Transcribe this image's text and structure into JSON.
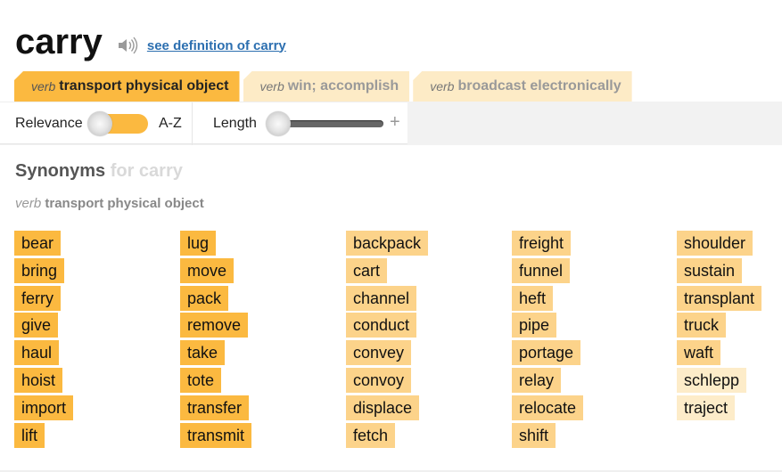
{
  "header": {
    "headword": "carry",
    "speaker_icon": "speaker-icon",
    "definition_link": "see definition of carry"
  },
  "tabs": [
    {
      "pos": "verb",
      "sense": "transport physical object",
      "active": true
    },
    {
      "pos": "verb",
      "sense": "win; accomplish",
      "active": false
    },
    {
      "pos": "verb",
      "sense": "broadcast electronically",
      "active": false
    }
  ],
  "controls": {
    "sort_left_label": "Relevance",
    "sort_right_label": "A-Z",
    "sort_value": "Relevance",
    "length_label": "Length",
    "length_value": 0,
    "plus_label": "+"
  },
  "synonyms": {
    "title": "Synonyms",
    "title_for": "for carry",
    "pos": "verb",
    "sense": "transport physical object",
    "colors": {
      "most_relevant": "#fbb940",
      "relevant": "#fcd38a",
      "less_relevant": "#fdecc9"
    },
    "columns": [
      [
        {
          "word": "bear",
          "relevance": 1
        },
        {
          "word": "bring",
          "relevance": 1
        },
        {
          "word": "ferry",
          "relevance": 1
        },
        {
          "word": "give",
          "relevance": 1
        },
        {
          "word": "haul",
          "relevance": 1
        },
        {
          "word": "hoist",
          "relevance": 1
        },
        {
          "word": "import",
          "relevance": 1
        },
        {
          "word": "lift",
          "relevance": 1
        }
      ],
      [
        {
          "word": "lug",
          "relevance": 1
        },
        {
          "word": "move",
          "relevance": 1
        },
        {
          "word": "pack",
          "relevance": 1
        },
        {
          "word": "remove",
          "relevance": 1
        },
        {
          "word": "take",
          "relevance": 1
        },
        {
          "word": "tote",
          "relevance": 1
        },
        {
          "word": "transfer",
          "relevance": 1
        },
        {
          "word": "transmit",
          "relevance": 1
        }
      ],
      [
        {
          "word": "backpack",
          "relevance": 2
        },
        {
          "word": "cart",
          "relevance": 2
        },
        {
          "word": "channel",
          "relevance": 2
        },
        {
          "word": "conduct",
          "relevance": 2
        },
        {
          "word": "convey",
          "relevance": 2
        },
        {
          "word": "convoy",
          "relevance": 2
        },
        {
          "word": "displace",
          "relevance": 2
        },
        {
          "word": "fetch",
          "relevance": 2
        }
      ],
      [
        {
          "word": "freight",
          "relevance": 2
        },
        {
          "word": "funnel",
          "relevance": 2
        },
        {
          "word": "heft",
          "relevance": 2
        },
        {
          "word": "pipe",
          "relevance": 2
        },
        {
          "word": "portage",
          "relevance": 2
        },
        {
          "word": "relay",
          "relevance": 2
        },
        {
          "word": "relocate",
          "relevance": 2
        },
        {
          "word": "shift",
          "relevance": 2
        }
      ],
      [
        {
          "word": "shoulder",
          "relevance": 2
        },
        {
          "word": "sustain",
          "relevance": 2
        },
        {
          "word": "transplant",
          "relevance": 2
        },
        {
          "word": "truck",
          "relevance": 2
        },
        {
          "word": "waft",
          "relevance": 2
        },
        {
          "word": "schlepp",
          "relevance": 3
        },
        {
          "word": "traject",
          "relevance": 3
        }
      ]
    ]
  }
}
